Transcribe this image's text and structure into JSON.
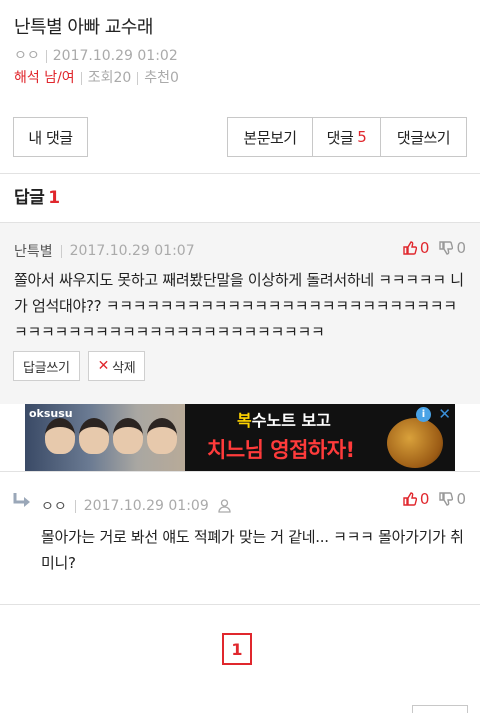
{
  "post": {
    "title": "난특별 아빠 교수래",
    "author": "ㅇㅇ",
    "date": "2017.10.29 01:02",
    "category": "해석 남/여",
    "views": "조회20",
    "recommend": "추천0"
  },
  "buttons": {
    "my_comments": "내 댓글",
    "view_post": "본문보기",
    "comments": "댓글",
    "comment_count": "5",
    "write_comment": "댓글쓰기"
  },
  "reply_section": {
    "label": "답글",
    "count": "1"
  },
  "comments": [
    {
      "author": "난특별",
      "date": "2017.10.29 01:07",
      "up": "0",
      "down": "0",
      "text": "쫄아서 싸우지도 못하고 째려봤단말을 이상하게 돌려서하네 ㅋㅋㅋㅋㅋ 니가 엄석대야?? ㅋㅋㅋㅋㅋㅋㅋㅋㅋㅋㅋㅋㅋㅋㅋㅋㅋㅋㅋㅋㅋㅋㅋㅋㅋㅋㅋㅋㅋㅋㅋㅋㅋㅋㅋㅋㅋㅋㅋㅋㅋㅋㅋㅋㅋㅋㅋㅋㅋ",
      "reply_button": "답글쓰기",
      "delete_button": "삭제"
    },
    {
      "author": "ㅇㅇ",
      "date": "2017.10.29 01:09",
      "up": "0",
      "down": "0",
      "text": "몰아가는 거로 봐선 얘도 적폐가 맞는 거 같네... ㅋㅋㅋ 몰아가기가 취미니?"
    }
  ],
  "ad": {
    "brand": "oksusu",
    "line1_a": "복",
    "line1_b": "수노트 보고",
    "line2": "치느님 영접하자!"
  },
  "pagination": {
    "current": "1"
  },
  "colors": {
    "accent": "#e0272d",
    "meta": "#aaaaaa",
    "comment_bg": "#f5f5f5"
  }
}
